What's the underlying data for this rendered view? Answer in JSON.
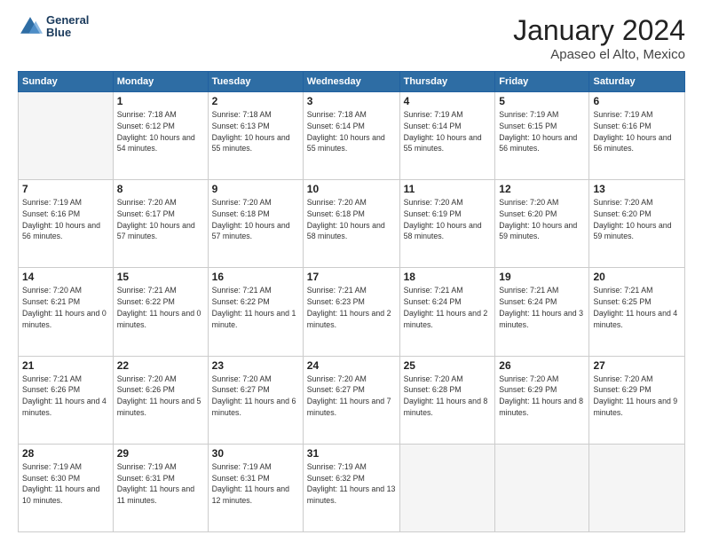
{
  "header": {
    "logo_line1": "General",
    "logo_line2": "Blue",
    "month": "January 2024",
    "location": "Apaseo el Alto, Mexico"
  },
  "weekdays": [
    "Sunday",
    "Monday",
    "Tuesday",
    "Wednesday",
    "Thursday",
    "Friday",
    "Saturday"
  ],
  "weeks": [
    [
      {
        "day": "",
        "empty": true
      },
      {
        "day": "1",
        "sunrise": "Sunrise: 7:18 AM",
        "sunset": "Sunset: 6:12 PM",
        "daylight": "Daylight: 10 hours and 54 minutes."
      },
      {
        "day": "2",
        "sunrise": "Sunrise: 7:18 AM",
        "sunset": "Sunset: 6:13 PM",
        "daylight": "Daylight: 10 hours and 55 minutes."
      },
      {
        "day": "3",
        "sunrise": "Sunrise: 7:18 AM",
        "sunset": "Sunset: 6:14 PM",
        "daylight": "Daylight: 10 hours and 55 minutes."
      },
      {
        "day": "4",
        "sunrise": "Sunrise: 7:19 AM",
        "sunset": "Sunset: 6:14 PM",
        "daylight": "Daylight: 10 hours and 55 minutes."
      },
      {
        "day": "5",
        "sunrise": "Sunrise: 7:19 AM",
        "sunset": "Sunset: 6:15 PM",
        "daylight": "Daylight: 10 hours and 56 minutes."
      },
      {
        "day": "6",
        "sunrise": "Sunrise: 7:19 AM",
        "sunset": "Sunset: 6:16 PM",
        "daylight": "Daylight: 10 hours and 56 minutes."
      }
    ],
    [
      {
        "day": "7",
        "sunrise": "Sunrise: 7:19 AM",
        "sunset": "Sunset: 6:16 PM",
        "daylight": "Daylight: 10 hours and 56 minutes."
      },
      {
        "day": "8",
        "sunrise": "Sunrise: 7:20 AM",
        "sunset": "Sunset: 6:17 PM",
        "daylight": "Daylight: 10 hours and 57 minutes."
      },
      {
        "day": "9",
        "sunrise": "Sunrise: 7:20 AM",
        "sunset": "Sunset: 6:18 PM",
        "daylight": "Daylight: 10 hours and 57 minutes."
      },
      {
        "day": "10",
        "sunrise": "Sunrise: 7:20 AM",
        "sunset": "Sunset: 6:18 PM",
        "daylight": "Daylight: 10 hours and 58 minutes."
      },
      {
        "day": "11",
        "sunrise": "Sunrise: 7:20 AM",
        "sunset": "Sunset: 6:19 PM",
        "daylight": "Daylight: 10 hours and 58 minutes."
      },
      {
        "day": "12",
        "sunrise": "Sunrise: 7:20 AM",
        "sunset": "Sunset: 6:20 PM",
        "daylight": "Daylight: 10 hours and 59 minutes."
      },
      {
        "day": "13",
        "sunrise": "Sunrise: 7:20 AM",
        "sunset": "Sunset: 6:20 PM",
        "daylight": "Daylight: 10 hours and 59 minutes."
      }
    ],
    [
      {
        "day": "14",
        "sunrise": "Sunrise: 7:20 AM",
        "sunset": "Sunset: 6:21 PM",
        "daylight": "Daylight: 11 hours and 0 minutes."
      },
      {
        "day": "15",
        "sunrise": "Sunrise: 7:21 AM",
        "sunset": "Sunset: 6:22 PM",
        "daylight": "Daylight: 11 hours and 0 minutes."
      },
      {
        "day": "16",
        "sunrise": "Sunrise: 7:21 AM",
        "sunset": "Sunset: 6:22 PM",
        "daylight": "Daylight: 11 hours and 1 minute."
      },
      {
        "day": "17",
        "sunrise": "Sunrise: 7:21 AM",
        "sunset": "Sunset: 6:23 PM",
        "daylight": "Daylight: 11 hours and 2 minutes."
      },
      {
        "day": "18",
        "sunrise": "Sunrise: 7:21 AM",
        "sunset": "Sunset: 6:24 PM",
        "daylight": "Daylight: 11 hours and 2 minutes."
      },
      {
        "day": "19",
        "sunrise": "Sunrise: 7:21 AM",
        "sunset": "Sunset: 6:24 PM",
        "daylight": "Daylight: 11 hours and 3 minutes."
      },
      {
        "day": "20",
        "sunrise": "Sunrise: 7:21 AM",
        "sunset": "Sunset: 6:25 PM",
        "daylight": "Daylight: 11 hours and 4 minutes."
      }
    ],
    [
      {
        "day": "21",
        "sunrise": "Sunrise: 7:21 AM",
        "sunset": "Sunset: 6:26 PM",
        "daylight": "Daylight: 11 hours and 4 minutes."
      },
      {
        "day": "22",
        "sunrise": "Sunrise: 7:20 AM",
        "sunset": "Sunset: 6:26 PM",
        "daylight": "Daylight: 11 hours and 5 minutes."
      },
      {
        "day": "23",
        "sunrise": "Sunrise: 7:20 AM",
        "sunset": "Sunset: 6:27 PM",
        "daylight": "Daylight: 11 hours and 6 minutes."
      },
      {
        "day": "24",
        "sunrise": "Sunrise: 7:20 AM",
        "sunset": "Sunset: 6:27 PM",
        "daylight": "Daylight: 11 hours and 7 minutes."
      },
      {
        "day": "25",
        "sunrise": "Sunrise: 7:20 AM",
        "sunset": "Sunset: 6:28 PM",
        "daylight": "Daylight: 11 hours and 8 minutes."
      },
      {
        "day": "26",
        "sunrise": "Sunrise: 7:20 AM",
        "sunset": "Sunset: 6:29 PM",
        "daylight": "Daylight: 11 hours and 8 minutes."
      },
      {
        "day": "27",
        "sunrise": "Sunrise: 7:20 AM",
        "sunset": "Sunset: 6:29 PM",
        "daylight": "Daylight: 11 hours and 9 minutes."
      }
    ],
    [
      {
        "day": "28",
        "sunrise": "Sunrise: 7:19 AM",
        "sunset": "Sunset: 6:30 PM",
        "daylight": "Daylight: 11 hours and 10 minutes."
      },
      {
        "day": "29",
        "sunrise": "Sunrise: 7:19 AM",
        "sunset": "Sunset: 6:31 PM",
        "daylight": "Daylight: 11 hours and 11 minutes."
      },
      {
        "day": "30",
        "sunrise": "Sunrise: 7:19 AM",
        "sunset": "Sunset: 6:31 PM",
        "daylight": "Daylight: 11 hours and 12 minutes."
      },
      {
        "day": "31",
        "sunrise": "Sunrise: 7:19 AM",
        "sunset": "Sunset: 6:32 PM",
        "daylight": "Daylight: 11 hours and 13 minutes."
      },
      {
        "day": "",
        "empty": true
      },
      {
        "day": "",
        "empty": true
      },
      {
        "day": "",
        "empty": true
      }
    ]
  ]
}
